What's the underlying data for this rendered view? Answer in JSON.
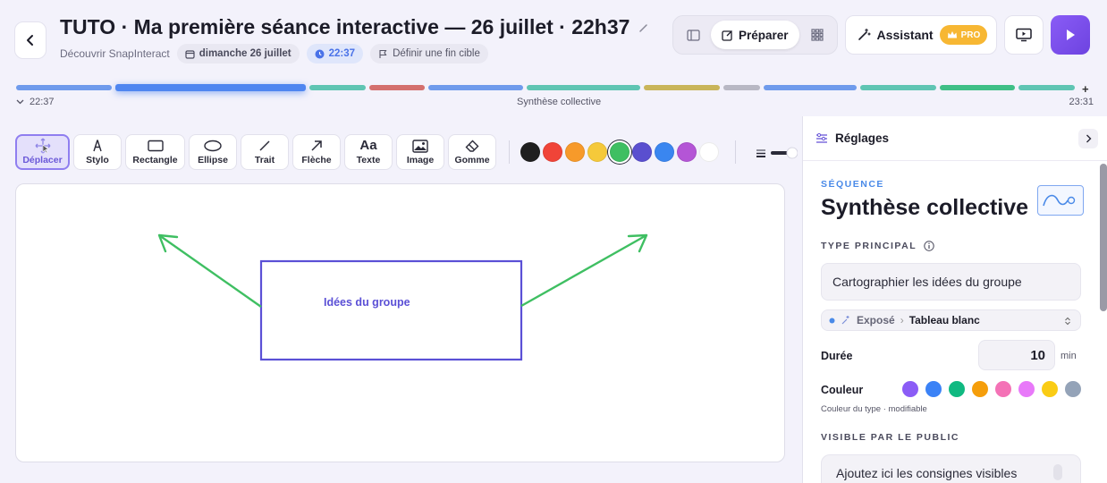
{
  "header": {
    "title": "TUTO · Ma première séance interactive — 26 juillet · 22h37",
    "subtitle": "Découvrir SnapInteract",
    "date_chip": "dimanche 26 juillet",
    "time_chip": "22:37",
    "end_target_chip": "Définir une fin cible",
    "prepare_label": "Préparer",
    "assistant_label": "Assistant",
    "pro_label": "PRO"
  },
  "timeline": {
    "start_time": "22:37",
    "current_label": "Synthèse collective",
    "end_time": "23:31",
    "add_label": "+",
    "segment_colors": [
      "#6f9bec",
      "#4f86f0",
      "#5fc5b3",
      "#d4706e",
      "#6f9bec",
      "#5fc5b3",
      "#c9b55a",
      "#b8b8c4",
      "#6f9bec",
      "#5fc5b3",
      "#3fbf86",
      "#5fc5b3"
    ]
  },
  "tools": [
    {
      "label": "Déplacer",
      "icon": "move-icon",
      "active": true
    },
    {
      "label": "Stylo",
      "icon": "pen-icon"
    },
    {
      "label": "Rectangle",
      "icon": "rectangle-icon"
    },
    {
      "label": "Ellipse",
      "icon": "ellipse-icon"
    },
    {
      "label": "Trait",
      "icon": "line-icon"
    },
    {
      "label": "Flèche",
      "icon": "arrow-icon"
    },
    {
      "label": "Texte",
      "icon": "text-icon",
      "glyph": "Aa"
    },
    {
      "label": "Image",
      "icon": "image-icon"
    },
    {
      "label": "Gomme",
      "icon": "eraser-icon"
    }
  ],
  "palette": [
    "#1f1f1f",
    "#f04438",
    "#f79a2a",
    "#f5c93a",
    "#3fbf62",
    "#5a4fcf",
    "#3a86f0",
    "#b455d6",
    "#ffffff"
  ],
  "selected_palette_index": 4,
  "canvas": {
    "box_text": "Idées du groupe",
    "box_color": "#5b50d6",
    "arrow_color": "#3fbf62"
  },
  "panel": {
    "title": "Réglages",
    "sequence_label": "SÉQUENCE",
    "sequence_title": "Synthèse collective",
    "type_label": "TYPE PRINCIPAL",
    "type_value": "Cartographier les idées du groupe",
    "breadcrumb_parent": "Exposé",
    "breadcrumb_sep": "›",
    "breadcrumb_child": "Tableau blanc",
    "duration_label": "Durée",
    "duration_value": "10",
    "duration_unit": "min",
    "color_label": "Couleur",
    "color_hint": "Couleur du type · modifiable",
    "type_colors": [
      "#8b5cf6",
      "#3b82f6",
      "#10b981",
      "#f59e0b",
      "#f472b6",
      "#e879f9",
      "#facc15",
      "#94a3b8"
    ],
    "visible_label": "VISIBLE PAR LE PUBLIC",
    "visible_placeholder": "Ajoutez ici les consignes visibles"
  }
}
